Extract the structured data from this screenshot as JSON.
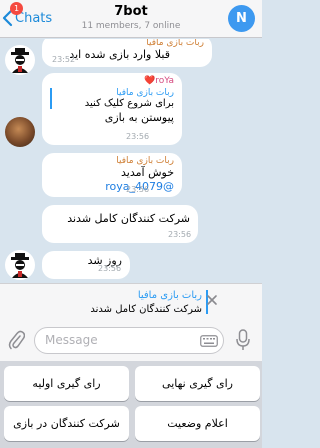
{
  "header": {
    "back_label": "Chats",
    "unread_count": "1",
    "title": "7bot",
    "subtitle": "11 members, 7 online",
    "avatar_letter": "N"
  },
  "messages": [
    {
      "sender": "ربات بازی مافیا",
      "text": "قبلا وارد بازی شده اید",
      "time": "23:52"
    },
    {
      "sender": "roYa❤️",
      "reply_name": "ربات بازی مافیا",
      "reply_text": "برای شروع کلیک کنید",
      "text": "پیوستن به بازی",
      "time": "23:56"
    },
    {
      "sender": "ربات بازی مافیا",
      "text_prefix": "خوش آمدید ",
      "mention": "@roya_4079",
      "time": "23:56"
    },
    {
      "text": "شرکت کنندگان کامل شدند",
      "time": "23:56"
    },
    {
      "text": "روز شد",
      "time": "23:56"
    }
  ],
  "reply_bar": {
    "name": "ربات بازی مافیا",
    "text": "شرکت کنندگان کامل شدند"
  },
  "input": {
    "placeholder": "Message"
  },
  "keyboard": {
    "buttons": [
      "رای گیری نهایی",
      "رای گیری اولیه",
      "اعلام وضعیت",
      "شرکت کنندگان در بازی"
    ]
  },
  "colors": {
    "accent": "#1c8ad9",
    "chat_background": "#d8e4ee",
    "bot_name": "#cf7f35"
  }
}
